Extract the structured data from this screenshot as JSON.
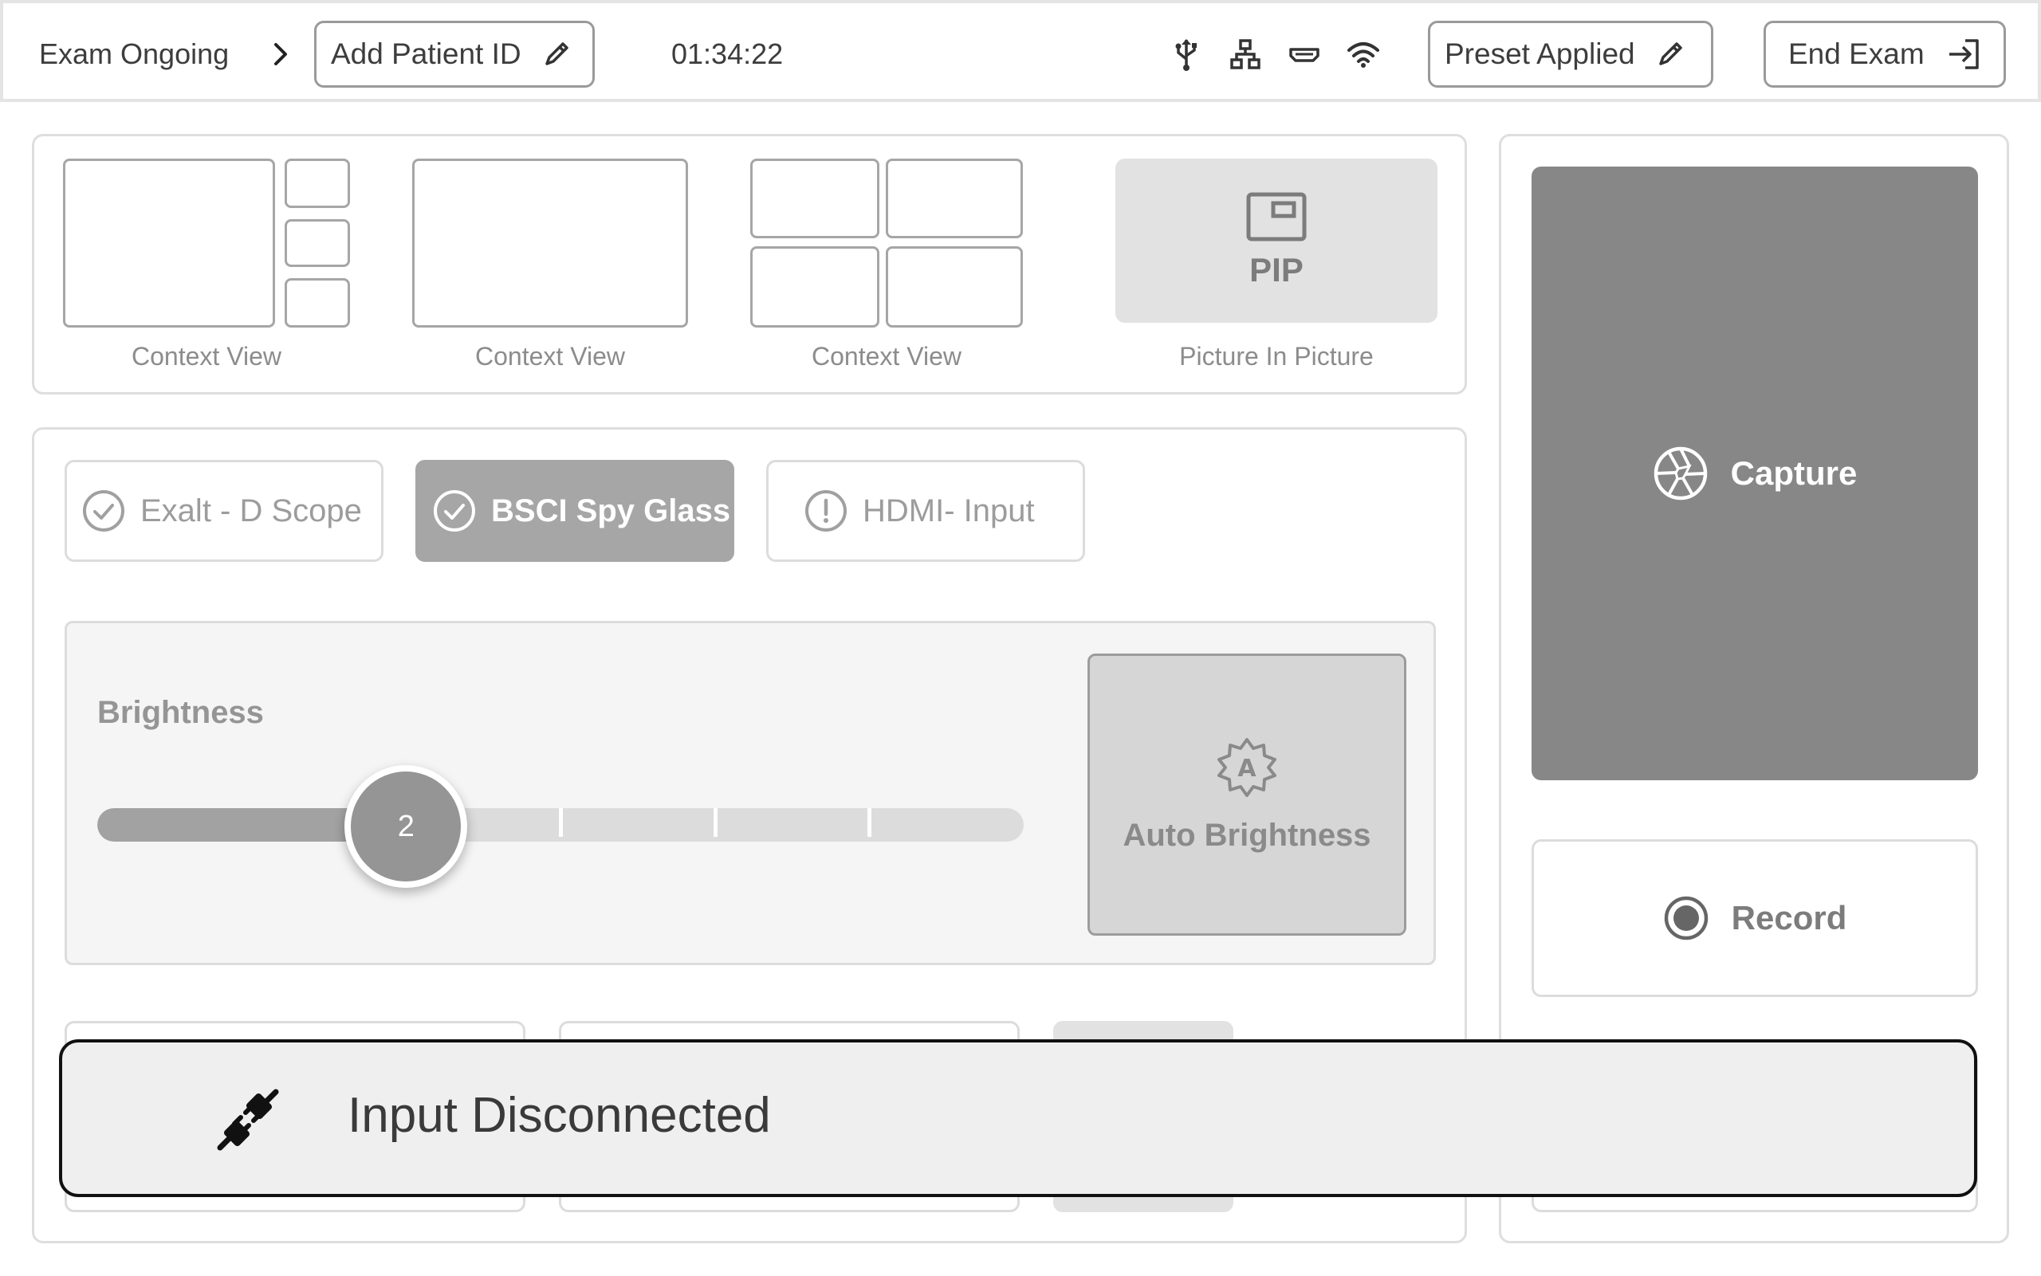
{
  "header": {
    "exam_status": "Exam Ongoing",
    "patient_button_label": "Add Patient ID",
    "timer": "01:34:22",
    "preset_button_label": "Preset Applied",
    "end_exam_label": "End Exam",
    "status_icons": [
      "usb-icon",
      "network-icon",
      "hdmi-icon",
      "wifi-icon"
    ]
  },
  "layouts": [
    {
      "label": "Context View",
      "icon": "layout-one-plus-three"
    },
    {
      "label": "Context View",
      "icon": "layout-single"
    },
    {
      "label": "Context View",
      "icon": "layout-quad"
    },
    {
      "label": "Picture In Picture",
      "tile_text": "PIP",
      "icon": "pip-icon"
    }
  ],
  "sources": [
    {
      "label": "Exalt - D Scope",
      "state": "connected",
      "icon": "check-circle-icon"
    },
    {
      "label": "BSCI Spy Glass",
      "state": "active",
      "icon": "check-circle-icon"
    },
    {
      "label": "HDMI- Input",
      "state": "warning",
      "icon": "alert-circle-icon"
    }
  ],
  "brightness": {
    "label": "Brightness",
    "value": "2",
    "level": 2,
    "max_level": 6,
    "auto_label": "Auto Brightness"
  },
  "actions": {
    "capture_label": "Capture",
    "record_label": "Record"
  },
  "toast": {
    "message": "Input Disconnected",
    "icon": "plug-disconnected-icon"
  },
  "colors": {
    "active_source": "#a6a6a6",
    "capture_bg": "#878787",
    "toast_border": "#111111"
  }
}
